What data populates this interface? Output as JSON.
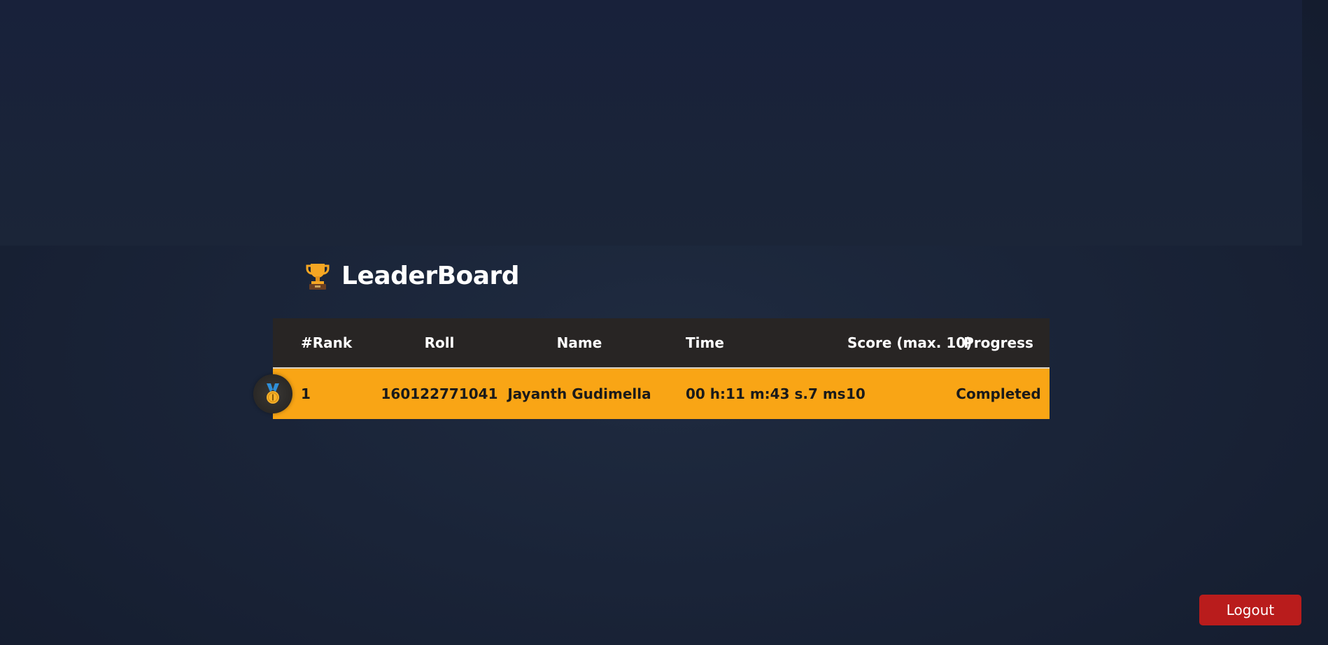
{
  "page": {
    "title": "LeaderBoard",
    "title_icon": "trophy-icon"
  },
  "table": {
    "columns": [
      "#Rank",
      "Roll",
      "Name",
      "Time",
      "Score (max. 10)",
      "Progress"
    ],
    "rows": [
      {
        "badge_icon": "medal-icon",
        "rank": "1",
        "roll": "160122771041",
        "name": "Jayanth Gudimella",
        "time": "00 h:11 m:43 s.7 ms",
        "score": "10",
        "progress": "Completed"
      }
    ]
  },
  "actions": {
    "logout_label": "Logout"
  },
  "colors": {
    "highlight_row": "#f9a515",
    "header_bg": "#282524",
    "logout_bg": "#b91c1c",
    "page_bg": "#1a2438"
  }
}
